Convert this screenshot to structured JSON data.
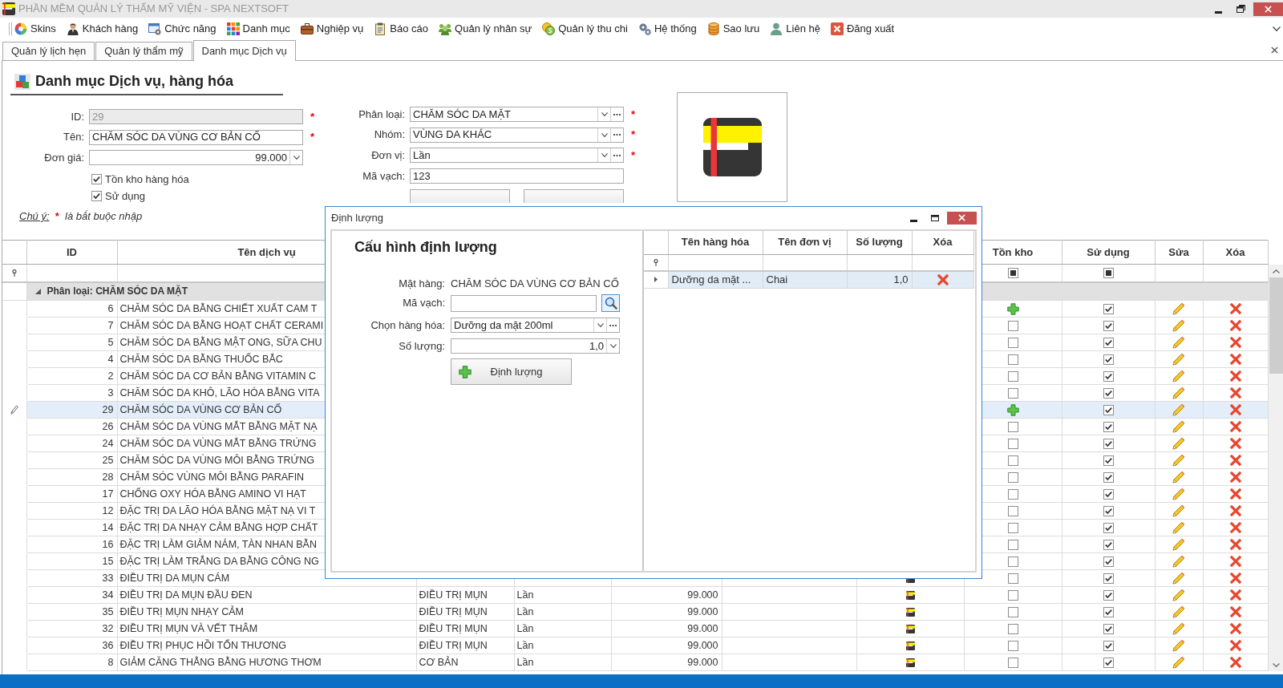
{
  "window": {
    "title": "PHẦN MỀM QUẢN LÝ THẨM MỸ VIỆN - SPA NEXTSOFT"
  },
  "menu": [
    {
      "label": "Skins"
    },
    {
      "label": "Khách hàng"
    },
    {
      "label": "Chức năng"
    },
    {
      "label": "Danh mục"
    },
    {
      "label": "Nghiệp vụ"
    },
    {
      "label": "Báo cáo"
    },
    {
      "label": "Quản lý nhân sự"
    },
    {
      "label": "Quản lý thu chi"
    },
    {
      "label": "Hệ thống"
    },
    {
      "label": "Sao lưu"
    },
    {
      "label": "Liên hệ"
    },
    {
      "label": "Đăng xuất"
    }
  ],
  "tabs": [
    {
      "label": "Quản lý lịch hẹn",
      "selected": false
    },
    {
      "label": "Quản lý thẩm mỹ",
      "selected": false
    },
    {
      "label": "Danh mục Dịch vụ",
      "selected": true
    }
  ],
  "page": {
    "title": "Danh mục Dịch vụ, hàng hóa"
  },
  "form": {
    "left_fields": [
      {
        "label": "ID:",
        "kind": "text",
        "value": "29",
        "disabled": true,
        "required_mark": "*"
      },
      {
        "label": "Tên:",
        "kind": "text",
        "value": "CHĂM SÓC DA VÙNG CƠ BẢN CỐ",
        "disabled": false,
        "required_mark": "*"
      },
      {
        "label": "Đơn giá:",
        "kind": "spin",
        "value": "99.000",
        "disabled": false
      }
    ],
    "checkboxes": [
      {
        "label": "Tồn kho hàng hóa",
        "checked": true
      },
      {
        "label": "Sử dụng",
        "checked": true
      }
    ],
    "note": {
      "label": "Chú ý:",
      "mark": "*",
      "text": "là bắt buộc nhập"
    },
    "right_fields": [
      {
        "label": "Phân loại:",
        "kind": "combo",
        "value": "CHĂM SÓC DA MẶT",
        "disabled": false,
        "required_mark": "*"
      },
      {
        "label": "Nhóm:",
        "kind": "combo",
        "value": "VÙNG DA KHÁC",
        "disabled": false,
        "required_mark": "*"
      },
      {
        "label": "Đơn vị:",
        "kind": "combo",
        "value": "Lần",
        "disabled": false,
        "required_mark": "*"
      },
      {
        "label": "Mã vạch:",
        "kind": "text",
        "value": "123",
        "disabled": false
      }
    ]
  },
  "grid": {
    "columns": [
      {
        "kind": "id",
        "label": "ID"
      },
      {
        "kind": "name",
        "label": "Tên dịch vụ"
      },
      {
        "kind": "stock",
        "label": "Tồn kho"
      },
      {
        "kind": "active",
        "label": "Sử dụng"
      },
      {
        "kind": "edit",
        "label": "Sửa"
      },
      {
        "kind": "delete",
        "label": "Xóa"
      }
    ],
    "filter": {
      "stock": {
        "indeterminate": true
      },
      "active": {
        "indeterminate": true
      }
    },
    "group": {
      "label": "Phân loại: CHĂM SÓC DA MẶT",
      "expanded": true
    },
    "rows": [
      {
        "id": "6",
        "name": "CHĂM SÓC DA BẰNG CHIẾT XUẤT CAM T",
        "selected": false,
        "stock": {
          "kind": "add"
        },
        "active": true
      },
      {
        "id": "7",
        "name": "CHĂM SÓC DA BẰNG HOẠT CHẤT CERAMI",
        "selected": false,
        "stock": {
          "kind": "checkbox",
          "checked": false
        },
        "active": true
      },
      {
        "id": "5",
        "name": "CHĂM SÓC DA BẰNG MẬT ONG, SỮA CHU",
        "selected": false,
        "stock": {
          "kind": "checkbox",
          "checked": false
        },
        "active": true
      },
      {
        "id": "4",
        "name": "CHĂM SÓC DA BẰNG THUỐC BẮC",
        "selected": false,
        "stock": {
          "kind": "checkbox",
          "checked": false
        },
        "active": true
      },
      {
        "id": "2",
        "name": "CHĂM SÓC DA CƠ BẢN BẰNG VITAMIN C",
        "selected": false,
        "stock": {
          "kind": "checkbox",
          "checked": false
        },
        "active": true
      },
      {
        "id": "3",
        "name": "CHĂM SÓC DA KHÔ, LÃO HÓA BẰNG VITA",
        "selected": false,
        "stock": {
          "kind": "checkbox",
          "checked": false
        },
        "active": true
      },
      {
        "id": "29",
        "name": "CHĂM SÓC DA VÙNG CƠ BẢN CỐ",
        "selected": true,
        "stock": {
          "kind": "add"
        },
        "active": true
      },
      {
        "id": "26",
        "name": "CHĂM SÓC DA VÙNG MẮT BẰNG MẶT NẠ",
        "selected": false,
        "stock": {
          "kind": "checkbox",
          "checked": false
        },
        "active": true
      },
      {
        "id": "24",
        "name": "CHĂM SÓC DA VÙNG MẮT BẰNG TRỨNG",
        "selected": false,
        "stock": {
          "kind": "checkbox",
          "checked": false
        },
        "active": true
      },
      {
        "id": "25",
        "name": "CHĂM SÓC DA VÙNG MÔI BẰNG TRỨNG",
        "selected": false,
        "stock": {
          "kind": "checkbox",
          "checked": false
        },
        "active": true
      },
      {
        "id": "28",
        "name": "CHĂM SÓC VÙNG MÔI BẰNG PARAFIN",
        "selected": false,
        "stock": {
          "kind": "checkbox",
          "checked": false
        },
        "active": true
      },
      {
        "id": "17",
        "name": "CHỐNG OXY HÓA BẰNG AMINO VI HẠT",
        "selected": false,
        "stock": {
          "kind": "checkbox",
          "checked": false
        },
        "active": true
      },
      {
        "id": "12",
        "name": "ĐẶC TRỊ DA LÃO HÓA BẰNG MẶT NẠ VI T",
        "selected": false,
        "stock": {
          "kind": "checkbox",
          "checked": false
        },
        "active": true
      },
      {
        "id": "14",
        "name": "ĐẶC TRỊ DA NHẠY CẢM BẰNG HỢP CHẤT",
        "selected": false,
        "stock": {
          "kind": "checkbox",
          "checked": false
        },
        "active": true
      },
      {
        "id": "16",
        "name": "ĐẶC TRỊ LÀM GIẢM NÁM, TÀN NHAN BẰN",
        "selected": false,
        "stock": {
          "kind": "checkbox",
          "checked": false
        },
        "active": true
      },
      {
        "id": "15",
        "name": "ĐẶC TRỊ LÀM TRẮNG DA BẰNG CÔNG NG",
        "selected": false,
        "stock": {
          "kind": "checkbox",
          "checked": false
        },
        "active": true
      },
      {
        "id": "33",
        "name": "ĐIỀU TRỊ DA MỤN CÁM",
        "image": true,
        "selected": false,
        "stock": {
          "kind": "checkbox",
          "checked": false
        },
        "active": true
      },
      {
        "id": "34",
        "name": "ĐIỀU TRỊ DA MỤN ĐẦU ĐEN",
        "category": "ĐIỀU TRỊ MỤN",
        "unit": "Lần",
        "price": "99.000",
        "image": true,
        "selected": false,
        "stock": {
          "kind": "checkbox",
          "checked": false
        },
        "active": true
      },
      {
        "id": "35",
        "name": "ĐIỀU TRỊ MỤN NHẠY CẢM",
        "category": "ĐIỀU TRỊ MỤN",
        "unit": "Lần",
        "price": "99.000",
        "image": true,
        "selected": false,
        "stock": {
          "kind": "checkbox",
          "checked": false
        },
        "active": true
      },
      {
        "id": "32",
        "name": "ĐIỀU TRỊ MỤN VÀ VẾT THÂM",
        "category": "ĐIỀU TRỊ MỤN",
        "unit": "Lần",
        "price": "99.000",
        "image": true,
        "selected": false,
        "stock": {
          "kind": "checkbox",
          "checked": false
        },
        "active": true
      },
      {
        "id": "36",
        "name": "ĐIỀU TRỊ PHỤC HỒI TỔN THƯƠNG",
        "category": "ĐIỀU TRỊ MỤN",
        "unit": "Lần",
        "price": "99.000",
        "image": true,
        "selected": false,
        "stock": {
          "kind": "checkbox",
          "checked": false
        },
        "active": true
      },
      {
        "id": "8",
        "name": "GIẢM CĂNG THẲNG BẰNG HƯƠNG THƠM",
        "category": "CƠ BẢN",
        "unit": "Lần",
        "price": "99.000",
        "image": true,
        "selected": false,
        "stock": {
          "kind": "checkbox",
          "checked": false
        },
        "active": true
      }
    ]
  },
  "dialog": {
    "title": "Định lượng",
    "heading": "Cấu hình định lượng",
    "fields": [
      {
        "kind": "static",
        "label": "Mặt hàng:",
        "value": "CHĂM SÓC DA VÙNG CƠ BẢN CỐ"
      },
      {
        "kind": "search",
        "label": "Mã vạch:"
      },
      {
        "kind": "combo",
        "label": "Chọn hàng hóa:",
        "value": "Dưỡng da mặt 200ml"
      },
      {
        "kind": "spin",
        "label": "Số lượng:",
        "value": "1,0"
      }
    ],
    "button": {
      "label": "Định lượng"
    },
    "grid": {
      "columns": [
        {
          "label": "Tên hàng hóa"
        },
        {
          "label": "Tên đơn vị"
        },
        {
          "label": "Số lượng"
        },
        {
          "label": "Xóa"
        }
      ],
      "rows": [
        {
          "name": "Dưỡng da mặt ...",
          "unit": "Chai",
          "quantity": "1,0",
          "selected": true
        }
      ]
    }
  }
}
